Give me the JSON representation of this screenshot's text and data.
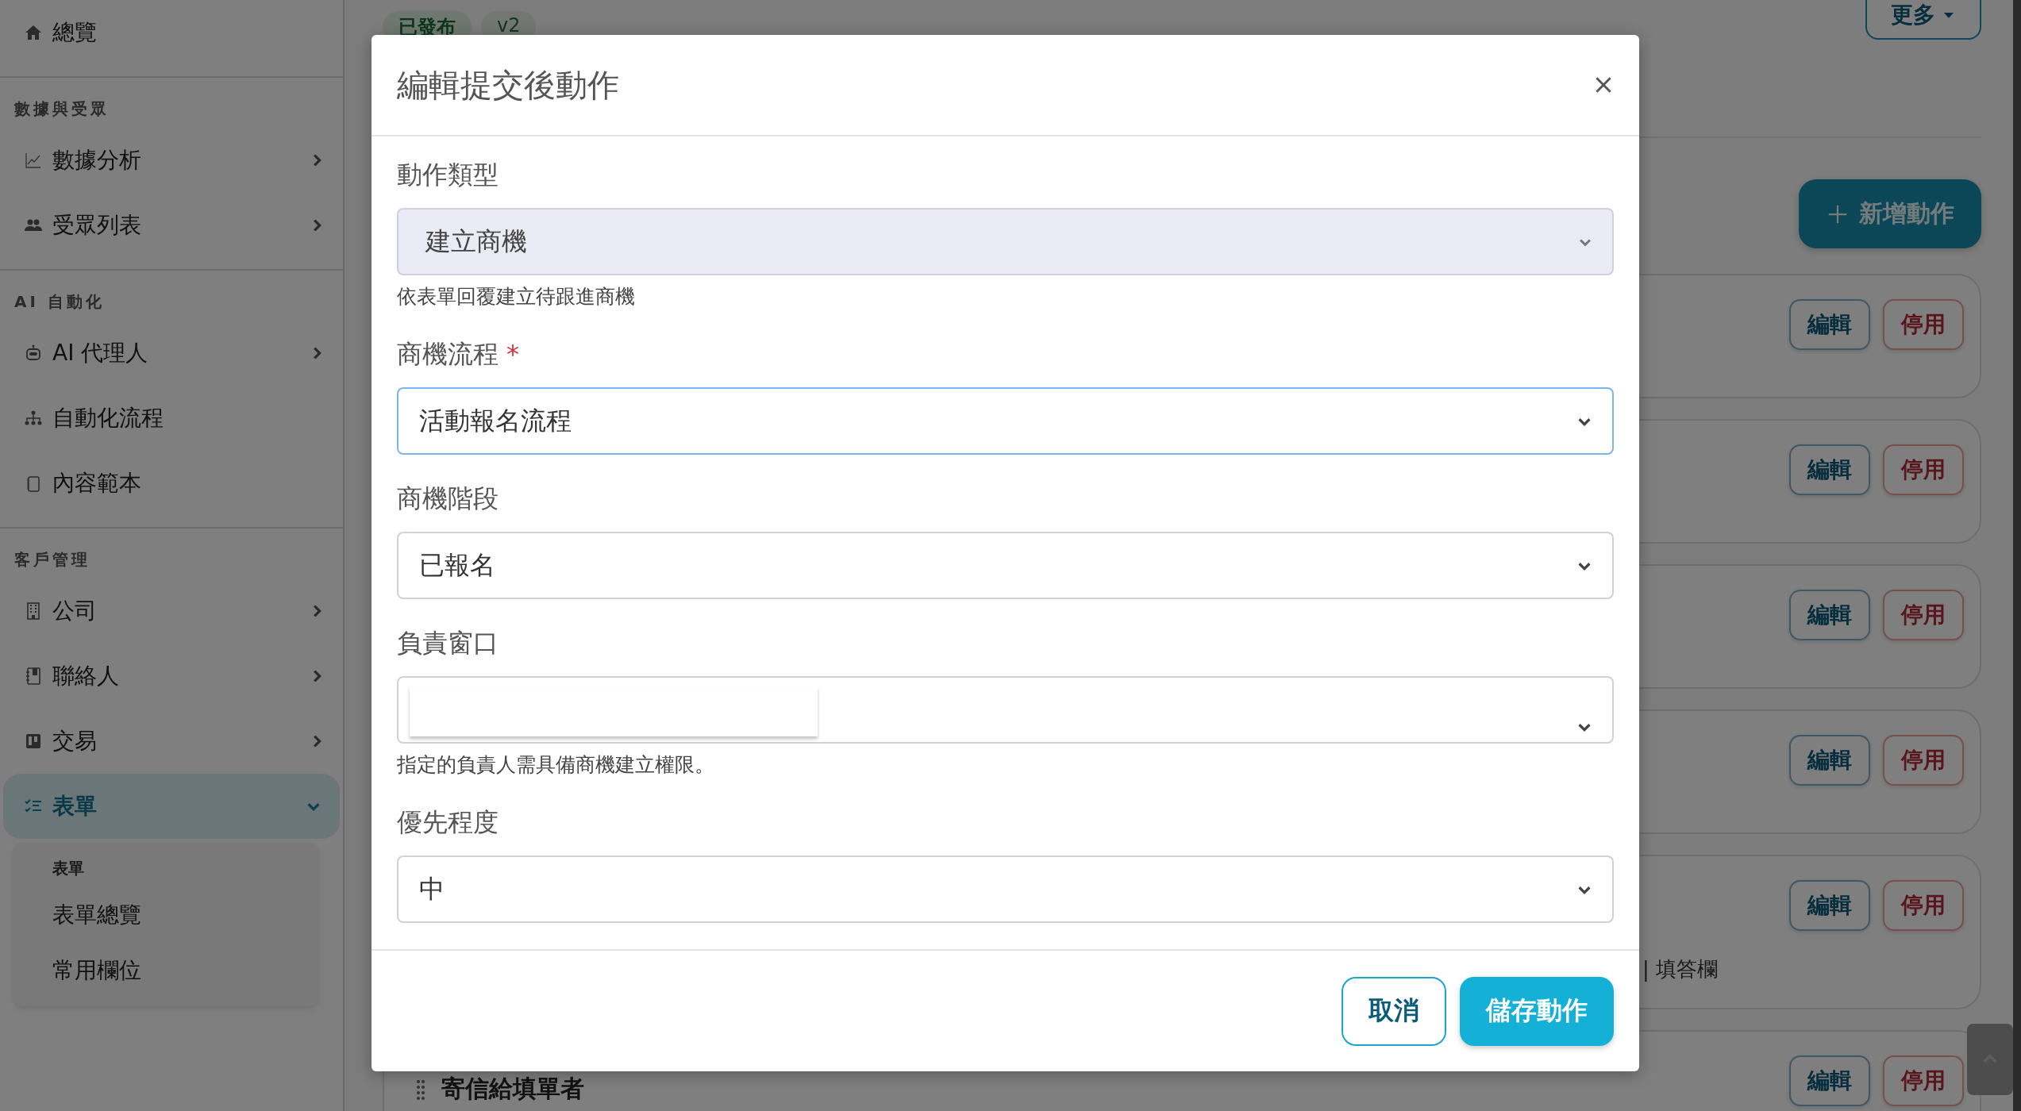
{
  "sidebar": {
    "sections": [
      {
        "items": [
          {
            "kind": "link",
            "label": "總覽",
            "selected": false
          }
        ]
      },
      {
        "heading": "數據與受眾",
        "items": [
          {
            "kind": "group",
            "label": "數據分析",
            "expanded": false,
            "selected": false
          },
          {
            "kind": "group",
            "label": "受眾列表",
            "expanded": false,
            "selected": false
          }
        ]
      },
      {
        "heading": "AI 自動化",
        "items": [
          {
            "kind": "group",
            "label": "AI 代理人",
            "expanded": false,
            "selected": false
          },
          {
            "kind": "link",
            "label": "自動化流程",
            "selected": false
          },
          {
            "kind": "link",
            "label": "內容範本",
            "selected": false
          }
        ]
      },
      {
        "heading": "客戶管理",
        "items": [
          {
            "kind": "group",
            "label": "公司",
            "expanded": false,
            "selected": false
          },
          {
            "kind": "group",
            "label": "聯絡人",
            "expanded": false,
            "selected": false
          },
          {
            "kind": "group",
            "label": "交易",
            "expanded": false,
            "selected": false
          },
          {
            "kind": "group",
            "label": "表單",
            "expanded": true,
            "selected": true,
            "children": {
              "heading": "表單",
              "items": [
                {
                  "label": "表單總覽",
                  "selected": false
                },
                {
                  "label": "常用欄位",
                  "selected": false
                }
              ]
            }
          }
        ]
      }
    ]
  },
  "main": {
    "badges": [
      {
        "label": "已發布",
        "kind": "status"
      },
      {
        "label": "v2",
        "kind": "version"
      }
    ],
    "more_button": "更多",
    "add_button": "新增動作",
    "actions": [
      {
        "edit": "編輯",
        "disable": "停用"
      },
      {
        "edit": "編輯",
        "disable": "停用"
      },
      {
        "edit": "編輯",
        "disable": "停用"
      },
      {
        "edit": "編輯",
        "disable": "停用"
      },
      {
        "edit": "編輯",
        "disable": "停用",
        "meta": "| 填答欄"
      },
      {
        "edit": "編輯",
        "disable": "停用",
        "title": "寄信給填單者"
      }
    ]
  },
  "modal": {
    "title": "編輯提交後動作",
    "fields": [
      {
        "kind": "select",
        "label": "動作類型",
        "value": "建立商機",
        "disabled": true,
        "focused": false,
        "help": "依表單回覆建立待跟進商機"
      },
      {
        "kind": "select",
        "label": "商機流程",
        "required_mark": "*",
        "value": "活動報名流程",
        "disabled": false,
        "focused": true
      },
      {
        "kind": "select",
        "label": "商機階段",
        "value": "已報名",
        "disabled": false,
        "focused": false
      },
      {
        "kind": "search-select",
        "label": "負責窗口",
        "disabled": false,
        "focused": false,
        "help": "指定的負責人需具備商機建立權限。"
      },
      {
        "kind": "select",
        "label": "優先程度",
        "value": "中",
        "disabled": false,
        "focused": false
      }
    ],
    "buttons": [
      {
        "kind": "secondary",
        "label": "取消"
      },
      {
        "kind": "primary",
        "label": "儲存動作"
      }
    ]
  }
}
